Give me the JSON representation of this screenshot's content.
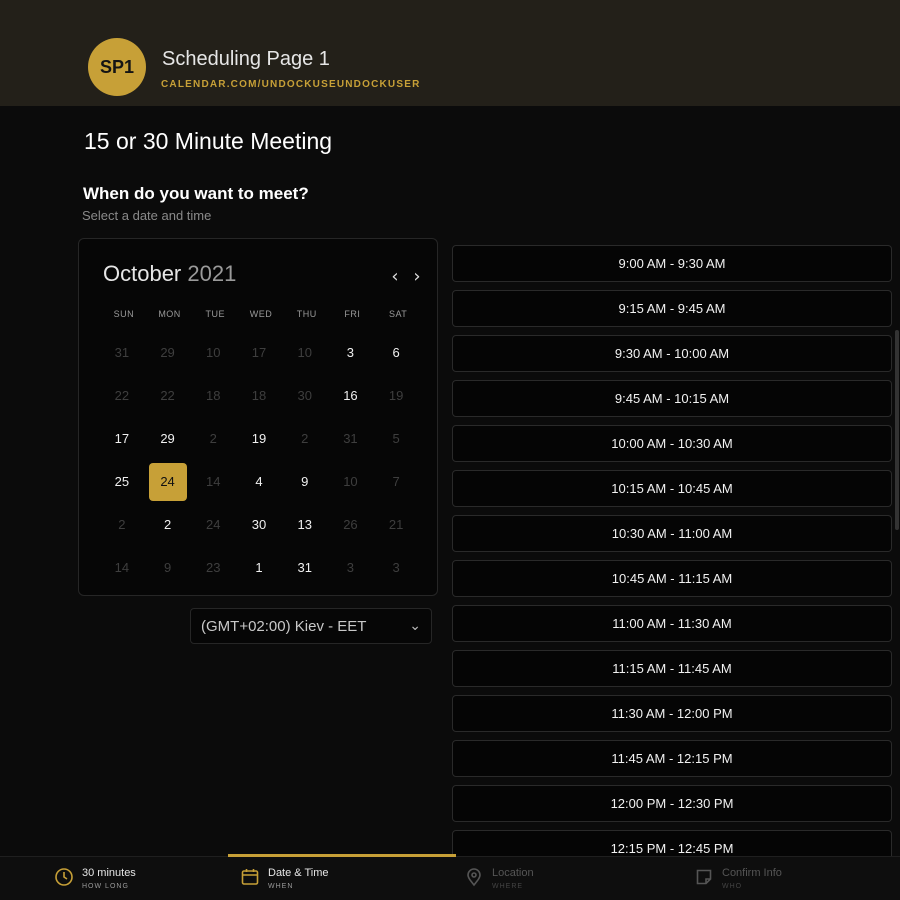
{
  "header": {
    "avatar_initials": "SP1",
    "page_name": "Scheduling Page 1",
    "page_url": "CALENDAR.COM/UNDOCKUSEUNDOCKUSER"
  },
  "meeting": {
    "title": "15 or 30 Minute Meeting",
    "prompt": "When do you want to meet?",
    "prompt_sub": "Select a date and time"
  },
  "calendar": {
    "month": "October",
    "year": "2021",
    "prev_icon": "chevron-left-icon",
    "next_icon": "chevron-right-icon",
    "weekdays": [
      "SUN",
      "MON",
      "TUE",
      "WED",
      "THU",
      "FRI",
      "SAT"
    ],
    "days": [
      {
        "d": "31",
        "s": "off"
      },
      {
        "d": "29",
        "s": "off"
      },
      {
        "d": "10",
        "s": "off"
      },
      {
        "d": "17",
        "s": "off"
      },
      {
        "d": "10",
        "s": "off"
      },
      {
        "d": "3",
        "s": "on"
      },
      {
        "d": "6",
        "s": "on"
      },
      {
        "d": "22",
        "s": "off"
      },
      {
        "d": "22",
        "s": "off"
      },
      {
        "d": "18",
        "s": "off"
      },
      {
        "d": "18",
        "s": "off"
      },
      {
        "d": "30",
        "s": "off"
      },
      {
        "d": "16",
        "s": "on"
      },
      {
        "d": "19",
        "s": "off"
      },
      {
        "d": "17",
        "s": "on"
      },
      {
        "d": "29",
        "s": "on"
      },
      {
        "d": "2",
        "s": "off"
      },
      {
        "d": "19",
        "s": "on"
      },
      {
        "d": "2",
        "s": "off"
      },
      {
        "d": "31",
        "s": "off"
      },
      {
        "d": "5",
        "s": "off"
      },
      {
        "d": "25",
        "s": "on"
      },
      {
        "d": "24",
        "s": "selected"
      },
      {
        "d": "14",
        "s": "off"
      },
      {
        "d": "4",
        "s": "on"
      },
      {
        "d": "9",
        "s": "on"
      },
      {
        "d": "10",
        "s": "off"
      },
      {
        "d": "7",
        "s": "off"
      },
      {
        "d": "2",
        "s": "off"
      },
      {
        "d": "2",
        "s": "on"
      },
      {
        "d": "24",
        "s": "off"
      },
      {
        "d": "30",
        "s": "on"
      },
      {
        "d": "13",
        "s": "on"
      },
      {
        "d": "26",
        "s": "off"
      },
      {
        "d": "21",
        "s": "off"
      },
      {
        "d": "14",
        "s": "off"
      },
      {
        "d": "9",
        "s": "off"
      },
      {
        "d": "23",
        "s": "off"
      },
      {
        "d": "1",
        "s": "on"
      },
      {
        "d": "31",
        "s": "on"
      },
      {
        "d": "3",
        "s": "off"
      },
      {
        "d": "3",
        "s": "off"
      }
    ]
  },
  "timezone": {
    "value": "(GMT+02:00) Kiev - EET",
    "icon": "chevron-down-icon"
  },
  "slots": [
    "9:00 AM - 9:30 AM",
    "9:15 AM - 9:45 AM",
    "9:30 AM - 10:00 AM",
    "9:45 AM - 10:15 AM",
    "10:00 AM - 10:30 AM",
    "10:15 AM - 10:45 AM",
    "10:30 AM - 11:00 AM",
    "10:45 AM - 11:15 AM",
    "11:00 AM - 11:30 AM",
    "11:15 AM - 11:45 AM",
    "11:30 AM - 12:00 PM",
    "11:45 AM - 12:15 PM",
    "12:00 PM - 12:30 PM",
    "12:15 PM - 12:45 PM"
  ],
  "steps": [
    {
      "label": "30 minutes",
      "sub": "HOW LONG",
      "icon": "clock-icon"
    },
    {
      "label": "Date & Time",
      "sub": "WHEN",
      "icon": "calendar-icon"
    },
    {
      "label": "Location",
      "sub": "WHERE",
      "icon": "map-pin-icon"
    },
    {
      "label": "Confirm Info",
      "sub": "WHO",
      "icon": "note-icon"
    }
  ],
  "colors": {
    "accent": "#c7a037",
    "background": "#0b0b0b",
    "header_bg": "#232019"
  }
}
